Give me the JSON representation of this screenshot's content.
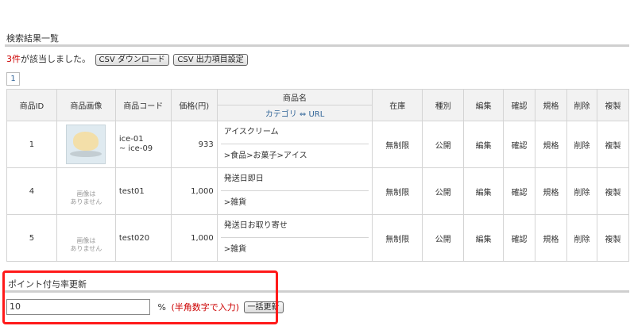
{
  "search": {
    "title": "検索結果一覧",
    "count": "3件",
    "count_suffix": "が該当しました。",
    "csv_download": "CSV ダウンロード",
    "csv_settings": "CSV 出力項目設定"
  },
  "pager": {
    "current": "1"
  },
  "table": {
    "headers": {
      "id": "商品ID",
      "image": "商品画像",
      "code": "商品コード",
      "price": "価格(円)",
      "name": "商品名",
      "name_sub": "カテゴリ ⇔ URL",
      "stock": "在庫",
      "type": "種別",
      "edit": "編集",
      "confirm": "確認",
      "spec": "規格",
      "delete": "削除",
      "copy": "複製"
    },
    "rows": [
      {
        "id": "1",
        "code": "ice-01\n~ ice-09",
        "price": "933",
        "name": "アイスクリーム",
        "category": ">食品>お菓子>アイス",
        "stock": "無制限",
        "type": "公開",
        "edit": "編集",
        "confirm": "確認",
        "spec": "規格",
        "delete": "削除",
        "copy": "複製",
        "has_image": true
      },
      {
        "id": "4",
        "no_image": "画像は\nありません",
        "code": "test01",
        "price": "1,000",
        "name": "発送日即日",
        "category": ">雑貨",
        "stock": "無制限",
        "type": "公開",
        "edit": "編集",
        "confirm": "確認",
        "spec": "規格",
        "delete": "削除",
        "copy": "複製",
        "has_image": false
      },
      {
        "id": "5",
        "no_image": "画像は\nありません",
        "code": "test020",
        "price": "1,000",
        "name": "発送日お取り寄せ",
        "category": ">雑貨",
        "stock": "無制限",
        "type": "公開",
        "edit": "編集",
        "confirm": "確認",
        "spec": "規格",
        "delete": "削除",
        "copy": "複製",
        "has_image": false
      }
    ]
  },
  "point": {
    "title": "ポイント付与率更新",
    "value": "10",
    "unit": "%",
    "hint": "(半角数字で入力)",
    "button": "一括更新"
  },
  "colors": {
    "highlight": "#ff1a1a",
    "count": "#cc0000",
    "link": "#336699"
  }
}
